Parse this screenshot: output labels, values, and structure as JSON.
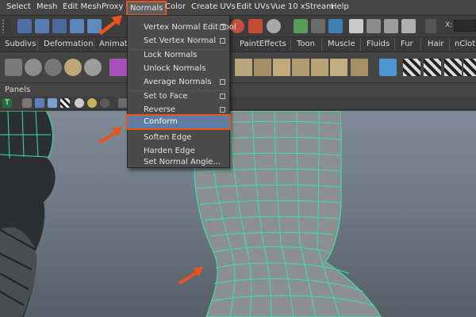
{
  "menubar": {
    "items": [
      "Select",
      "Mesh",
      "Edit Mesh",
      "Proxy",
      "Normals",
      "Color",
      "Create UVs",
      "Edit UVs",
      "Vue 10 xStream",
      "Help"
    ]
  },
  "status_line": {
    "x_label": "X:"
  },
  "shelf_tabs": [
    "Subdivs",
    "Deformation",
    "Animation",
    "PaintEffects",
    "Toon",
    "Muscle",
    "Fluids",
    "Fur",
    "Hair",
    "nCloth"
  ],
  "panels_label": "Panels",
  "normals_menu": {
    "items": [
      {
        "label": "Vertex Normal Edit Tool",
        "option_box": true
      },
      {
        "label": "Set Vertex Normal",
        "option_box": true
      },
      {
        "label": "Lock Normals",
        "option_box": false
      },
      {
        "label": "Unlock Normals",
        "option_box": false
      },
      {
        "label": "Average Normals",
        "option_box": true
      },
      {
        "label": "Set to Face",
        "option_box": true
      },
      {
        "label": "Reverse",
        "option_box": true
      },
      {
        "label": "Conform",
        "option_box": false,
        "highlighted": true
      },
      {
        "label": "Soften Edge",
        "option_box": false
      },
      {
        "label": "Harden Edge",
        "option_box": false
      },
      {
        "label": "Set Normal Angle...",
        "option_box": false
      }
    ]
  },
  "colors": {
    "highlight_outline": "#e8541c",
    "wireframe": "#36e3a4",
    "menu_highlight": "#5f7ca3"
  }
}
